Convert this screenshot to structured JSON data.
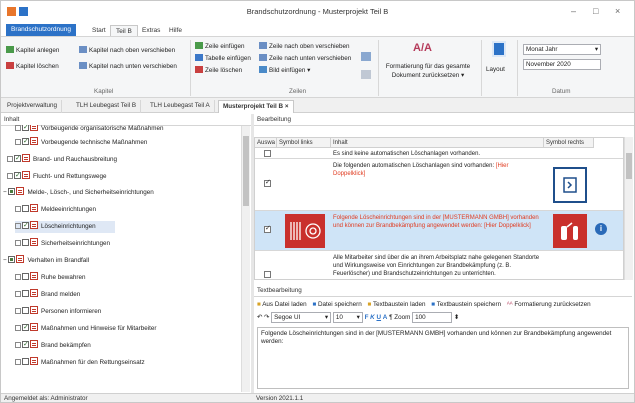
{
  "window": {
    "title": "Brandschutzordnung - Musterprojekt Teil B",
    "controls": {
      "minimize": "–",
      "maximize": "□",
      "close": "×"
    }
  },
  "menu_tabs": [
    {
      "label": "Brandschutzordnung",
      "kind": "file"
    },
    {
      "label": "Start"
    },
    {
      "label": "Teil B",
      "active": true
    },
    {
      "label": "Extras"
    },
    {
      "label": "Hilfe"
    }
  ],
  "ribbon": {
    "kapitel": {
      "anlegen": "Kapitel anlegen",
      "loeschen": "Kapitel löschen",
      "nach_oben": "Kapitel nach oben verschieben",
      "nach_unten": "Kapitel nach unten verschieben",
      "group": "Kapitel"
    },
    "zeilen": {
      "zeile_einfuegen": "Zeile einfügen",
      "tabelle_einfuegen": "Tabelle einfügen",
      "zeile_loeschen": "Zeile löschen",
      "zeile_oben": "Zeile nach oben verschieben",
      "zeile_unten": "Zeile nach unten verschieben",
      "bild_einfuegen": "Bild einfügen",
      "group": "Zeilen"
    },
    "format": {
      "icon_text": "A/A",
      "line1": "Formatierung für das gesamte",
      "line2": "Dokument zurücksetzen"
    },
    "layout": "Layout",
    "datum": {
      "format_value": "Monat Jahr",
      "date_value": "November 2020",
      "group": "Datum"
    }
  },
  "doc_tabs": [
    {
      "label": "Projektverwaltung"
    },
    {
      "label": "TLH Leubegast Teil B"
    },
    {
      "label": "TLH Leubegast Teil A"
    },
    {
      "label": "Musterprojekt Teil B",
      "active": true,
      "closable": "×"
    }
  ],
  "left_pane": {
    "header": "Inhalt",
    "items": [
      {
        "label": "Vorbeugende organisatorische Maßnahmen",
        "level": 2,
        "state": "checked"
      },
      {
        "label": "Vorbeugende technische Maßnahmen",
        "level": 2,
        "state": "checked"
      },
      {
        "label": "Brand- und Rauchausbreitung",
        "level": 1,
        "state": "checked"
      },
      {
        "label": "Flucht- und Rettungswege",
        "level": 1,
        "state": "checked"
      },
      {
        "label": "Melde-, Lösch-, und Sicherheitseinrichtungen",
        "level": 1,
        "state": "partial",
        "expander": "−"
      },
      {
        "label": "Meldeeinrichtungen",
        "level": 2,
        "state": "none"
      },
      {
        "label": "Löscheinrichtungen",
        "level": 2,
        "state": "checked",
        "selected": true
      },
      {
        "label": "Sicherheitseinrichtungen",
        "level": 2,
        "state": "none"
      },
      {
        "label": "Verhalten im Brandfall",
        "level": 1,
        "state": "partial",
        "expander": "−"
      },
      {
        "label": "Ruhe bewahren",
        "level": 2,
        "state": "none"
      },
      {
        "label": "Brand melden",
        "level": 2,
        "state": "none"
      },
      {
        "label": "Personen informieren",
        "level": 2,
        "state": "none"
      },
      {
        "label": "Maßnahmen und Hinweise für Mitarbeiter",
        "level": 2,
        "state": "checked"
      },
      {
        "label": "Brand bekämpfen",
        "level": 2,
        "state": "checked"
      },
      {
        "label": "Maßnahmen für den Rettungseinsatz",
        "level": 2,
        "state": "none"
      }
    ]
  },
  "right_pane": {
    "header": "Bearbeitung",
    "columns": [
      "Auswa",
      "Symbol links",
      "Inhalt",
      "Symbol rechts"
    ],
    "rows": [
      {
        "text": "Es sind keine automatischen Löschanlagen vorhanden.",
        "checked": false
      },
      {
        "text": "Die folgenden automatischen Löschanlagen sind vorhanden: ",
        "placeholder": "[Hier Doppelklick]",
        "checked": true
      },
      {
        "text": "Folgende Löscheinrichtungen sind in der [MUSTERMANN GMBH] vorhanden und können zur Brandbekämpfung angewendet werden: ",
        "placeholder": "[Hier Doppelklick]",
        "checked": true,
        "selected": true
      },
      {
        "text": "Alle Mitarbeiter sind über die an ihrem Arbeitsplatz nahe gelegenen Standorte und Wirkungsweise von Einrichtungen zur Brandbekämpfung (z. B. Feuerlöscher) und Brandschutzeinrichtungen zu unterrichten.",
        "checked": false
      }
    ],
    "symbol_colors": {
      "red": "#c9302c",
      "blue": "#1f4f8b",
      "info": "#2a6ab8"
    }
  },
  "textbearbeitung": {
    "header": "Textbearbeitung",
    "toolbar": {
      "aus_datei": "Aus Datei laden",
      "datei_speichern": "Datei speichern",
      "textbaustein_laden": "Textbaustein laden",
      "textbaustein_speichern": "Textbaustein speichern",
      "formatierung": "Formatierung zurücksetzen"
    },
    "font": "Segoe UI",
    "size": "10",
    "fmt": {
      "bold": "F",
      "italic": "K",
      "underline": "U",
      "font": "A"
    },
    "zoom_label": "Zoom",
    "zoom": "100",
    "content": "Folgende Löscheinrichtungen sind in der [MUSTERMANN GMBH] vorhanden und können zur Brandbekämpfung angewendet werden:"
  },
  "status": {
    "user": "Angemeldet als: Administrator",
    "version": "Version 2021.1.1"
  },
  "colors": {
    "accent": "#2c72c7",
    "selection": "#cfe4f7",
    "app_icon": "#e8762b"
  }
}
